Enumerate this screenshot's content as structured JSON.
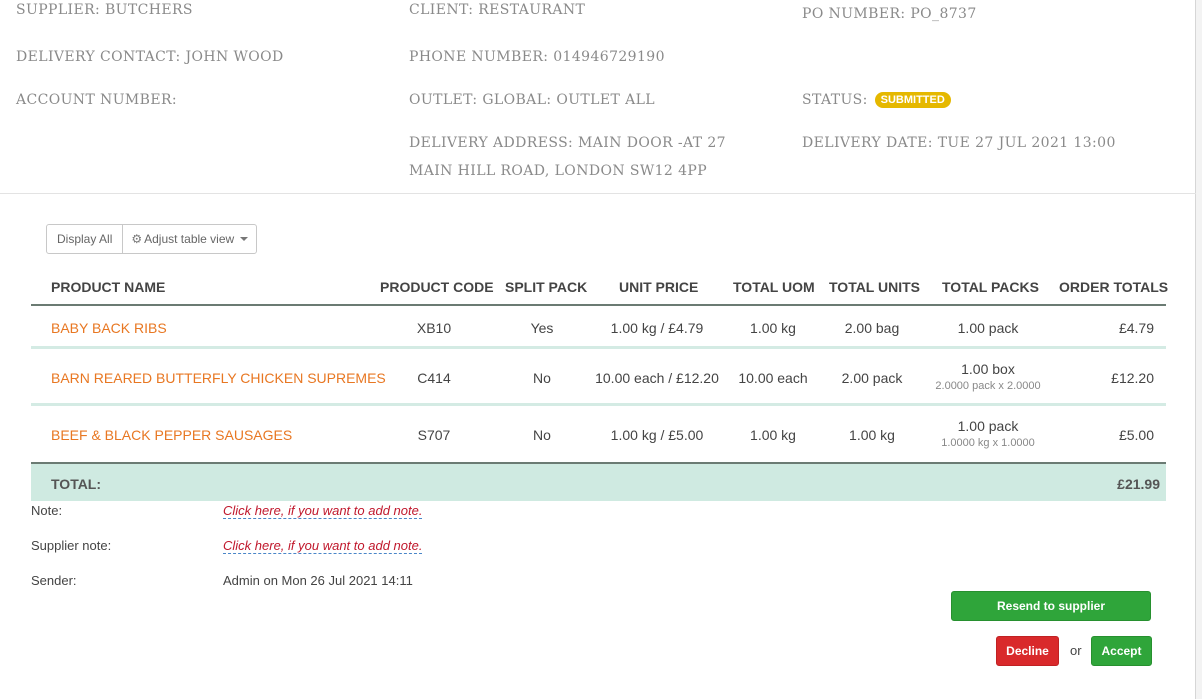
{
  "header": {
    "supplier": "SUPPLIER: BUTCHERS",
    "client": "CLIENT: RESTAURANT",
    "po_number": "PO NUMBER: PO_8737",
    "delivery_contact": "DELIVERY CONTACT: JOHN WOOD",
    "phone_number": "PHONE NUMBER: 014946729190",
    "account_number": "ACCOUNT NUMBER:",
    "outlet": "OUTLET: GLOBAL: OUTLET ALL",
    "status_label": "STATUS:",
    "status_badge": "SUBMITTED",
    "delivery_address_line1": "DELIVERY ADDRESS: MAIN DOOR -AT 27",
    "delivery_address_line2": "MAIN HILL ROAD, LONDON SW12 4PP",
    "delivery_date": "DELIVERY DATE: TUE 27 JUL 2021 13:00"
  },
  "toolbar": {
    "display_all": "Display All",
    "adjust_view": "Adjust table view"
  },
  "table": {
    "columns": [
      "PRODUCT NAME",
      "PRODUCT CODE",
      "SPLIT PACK",
      "UNIT PRICE",
      "TOTAL UOM",
      "TOTAL UNITS",
      "TOTAL PACKS",
      "ORDER TOTALS"
    ],
    "rows": [
      {
        "product_name": "BABY BACK RIBS",
        "product_code": "XB10",
        "split_pack": "Yes",
        "unit_price": "1.00 kg / £4.79",
        "total_uom": "1.00 kg",
        "total_units": "2.00 bag",
        "total_packs": "1.00 pack",
        "total_packs_sub": "",
        "order_total": "£4.79"
      },
      {
        "product_name": "BARN REARED BUTTERFLY CHICKEN SUPREMES",
        "product_code": "C414",
        "split_pack": "No",
        "unit_price": "10.00 each / £12.20",
        "total_uom": "10.00 each",
        "total_units": "2.00 pack",
        "total_packs": "1.00 box",
        "total_packs_sub": "2.0000 pack x 2.0000",
        "order_total": "£12.20"
      },
      {
        "product_name": "BEEF & BLACK PEPPER SAUSAGES",
        "product_code": "S707",
        "split_pack": "No",
        "unit_price": "1.00 kg / £5.00",
        "total_uom": "1.00 kg",
        "total_units": "1.00 kg",
        "total_packs": "1.00 pack",
        "total_packs_sub": "1.0000 kg x 1.0000",
        "order_total": "£5.00"
      }
    ],
    "total_label": "TOTAL:",
    "total_value": "£21.99"
  },
  "notes": {
    "note_label": "Note:",
    "note_link": "Click here, if you want to add note.",
    "supplier_note_label": "Supplier note:",
    "supplier_note_link": "Click here, if you want to add note.",
    "sender_label": "Sender:",
    "sender_value": "Admin on Mon 26 Jul 2021 14:11"
  },
  "actions": {
    "resend": "Resend to supplier",
    "decline": "Decline",
    "or": "or",
    "accept": "Accept"
  },
  "colors": {
    "accent_orange": "#e87722",
    "badge_yellow": "#e5b800",
    "total_bar": "#cfeae1",
    "button_green": "#2fa53a",
    "button_red": "#d9292b"
  }
}
